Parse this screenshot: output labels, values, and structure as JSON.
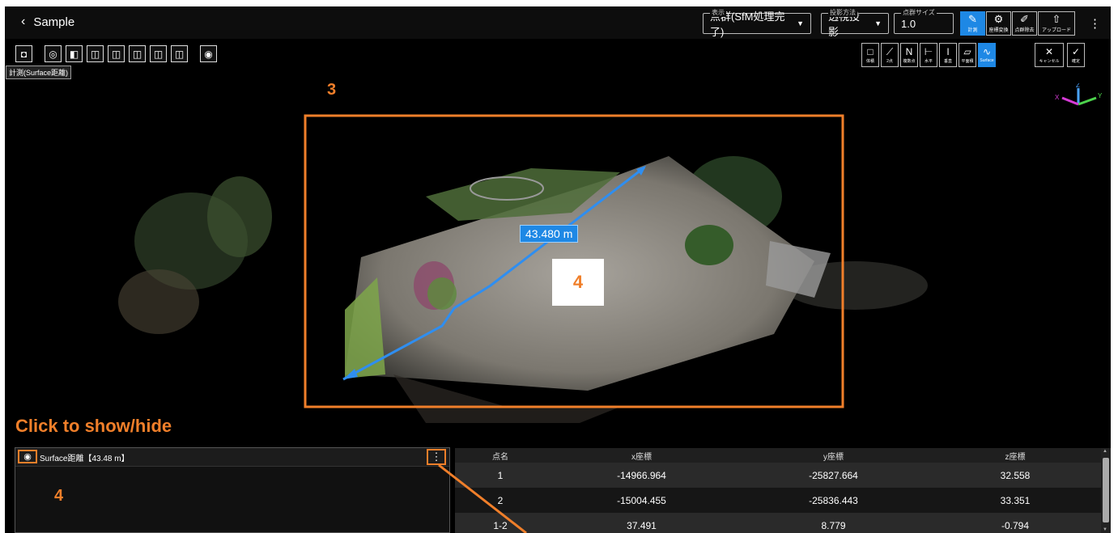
{
  "app": {
    "title": "Sample"
  },
  "header": {
    "display": {
      "label": "表示",
      "value": "点群(SfM処理完了)"
    },
    "projection": {
      "label": "投影方法",
      "value": "透視投影"
    },
    "pointsize": {
      "label": "点群サイズ",
      "value": "1.0"
    },
    "buttons": [
      {
        "label": "計測",
        "icon": "measure-icon",
        "active": true
      },
      {
        "label": "座標変換",
        "icon": "transform-icon",
        "active": false
      },
      {
        "label": "点群除去",
        "icon": "eraser-icon",
        "active": false
      },
      {
        "label": "アップロード",
        "icon": "upload-icon",
        "active": false
      }
    ]
  },
  "tooltip": "計測(Surface距離)",
  "measure_tools": [
    {
      "label": "体積",
      "icon": "volume-icon"
    },
    {
      "label": "2点",
      "icon": "two-point-icon"
    },
    {
      "label": "複数点",
      "icon": "multi-point-icon"
    },
    {
      "label": "水平",
      "icon": "horizontal-icon"
    },
    {
      "label": "垂直",
      "icon": "vertical-icon"
    },
    {
      "label": "平面積",
      "icon": "area-icon"
    },
    {
      "label": "Surface",
      "icon": "surface-icon"
    }
  ],
  "actions": {
    "cancel": "キャンセル",
    "confirm": "確定"
  },
  "scene": {
    "measurement_label": "43.480 m",
    "annotation_3": "3",
    "annotation_4_center": "4",
    "axes": {
      "x": "X",
      "y": "Y",
      "z": "Z"
    }
  },
  "hint": {
    "text": "Click to show/hide",
    "number": "4"
  },
  "left_panel": {
    "item_title": "Surface距離【43.48 m】"
  },
  "table": {
    "headers": [
      "点名",
      "x座標",
      "y座標",
      "z座標"
    ],
    "rows": [
      [
        "1",
        "-14966.964",
        "-25827.664",
        "32.558"
      ],
      [
        "2",
        "-15004.455",
        "-25836.443",
        "33.351"
      ],
      [
        "1-2",
        "37.491",
        "8.779",
        "-0.794"
      ]
    ]
  },
  "colors": {
    "accent": "#1e88e5",
    "annotation": "#f07f2a"
  }
}
